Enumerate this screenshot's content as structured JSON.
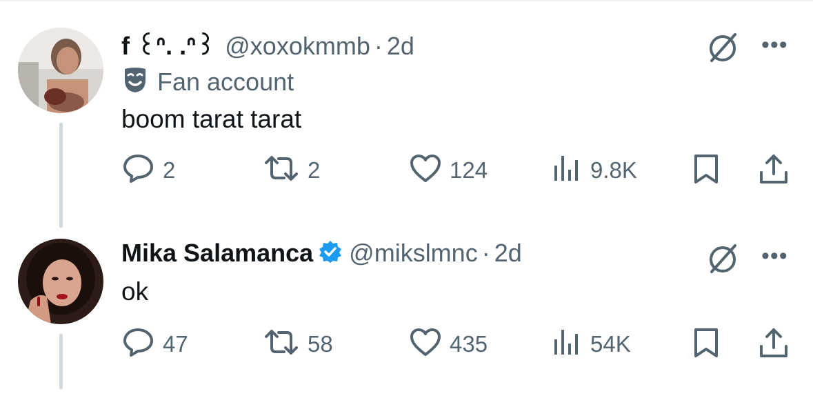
{
  "tweets": [
    {
      "display_name": "f ꒰ᐢ. .ᐢ꒱",
      "handle": "@xoxokmmb",
      "separator": "·",
      "time": "2d",
      "label": "Fan account",
      "text": "boom tarat tarat",
      "replies": "2",
      "retweets": "2",
      "likes": "124",
      "views": "9.8K"
    },
    {
      "display_name": "Mika Salamanca",
      "verified": true,
      "handle": "@mikslmnc",
      "separator": "·",
      "time": "2d",
      "text": "ok",
      "replies": "47",
      "retweets": "58",
      "likes": "435",
      "views": "54K"
    }
  ],
  "icons": {
    "reply": "reply-icon",
    "retweet": "retweet-icon",
    "like": "heart-icon",
    "views": "views-chart-icon",
    "bookmark": "bookmark-icon",
    "share": "share-icon",
    "grok": "grok-icon",
    "more": "more-icon",
    "fan": "fan-mask-icon",
    "verified": "verified-badge-icon"
  },
  "more_label": "•••",
  "colors": {
    "text": "#0f1419",
    "secondary": "#536471",
    "verified": "#1d9bf0",
    "line": "#cfd9de"
  }
}
